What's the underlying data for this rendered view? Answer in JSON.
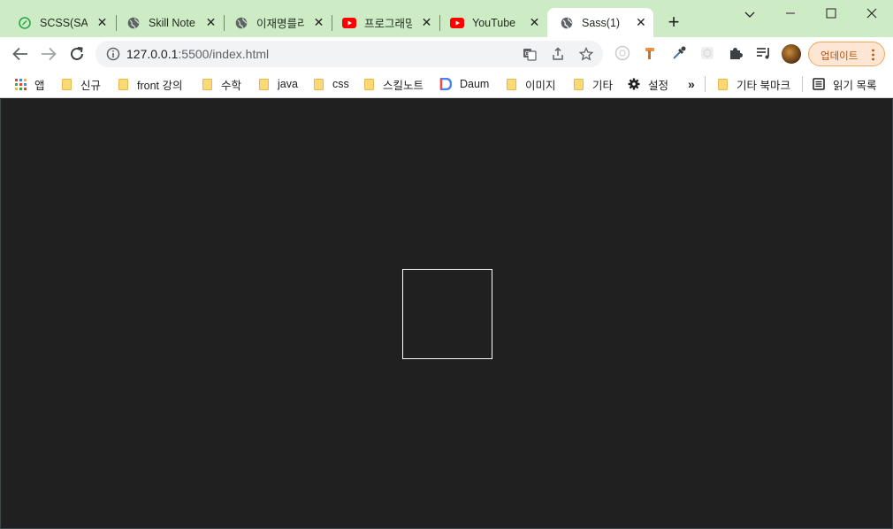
{
  "tabs": [
    {
      "title": "SCSS(SASS",
      "icon": "scss-icon",
      "active": false
    },
    {
      "title": "Skill Note",
      "icon": "globe-icon",
      "active": false
    },
    {
      "title": "이재명를리",
      "icon": "globe-icon",
      "active": false
    },
    {
      "title": "프로그래밍",
      "icon": "youtube-icon",
      "active": false
    },
    {
      "title": "YouTube",
      "icon": "youtube-icon",
      "active": false
    },
    {
      "title": "Sass(1)",
      "icon": "globe-icon",
      "active": true
    }
  ],
  "toolbar": {
    "url_host": "127.0.0.1",
    "url_path": ":5500/index.html",
    "update_label": "업데이트"
  },
  "bookmarks": [
    {
      "label": "앱",
      "icon": "apps-grid-icon"
    },
    {
      "label": "신규",
      "icon": "folder-icon"
    },
    {
      "label": "front 강의",
      "icon": "folder-icon"
    },
    {
      "label": "수학",
      "icon": "folder-icon"
    },
    {
      "label": "java",
      "icon": "folder-icon"
    },
    {
      "label": "css",
      "icon": "folder-icon"
    },
    {
      "label": "스킬노트",
      "icon": "folder-icon"
    },
    {
      "label": "Daum",
      "icon": "daum-icon"
    },
    {
      "label": "이미지",
      "icon": "folder-icon"
    },
    {
      "label": "기타",
      "icon": "folder-icon"
    },
    {
      "label": "설정",
      "icon": "gear-icon"
    },
    {
      "label": "»",
      "icon": ""
    },
    {
      "label": "기타 북마크",
      "icon": "folder-icon"
    },
    {
      "label": "읽기 목록",
      "icon": "reading-list-icon"
    }
  ],
  "colors": {
    "tabstrip": "#cdebc4",
    "page_background": "#202020",
    "box_border": "#ffffff",
    "update_accent": "#b8520b"
  }
}
